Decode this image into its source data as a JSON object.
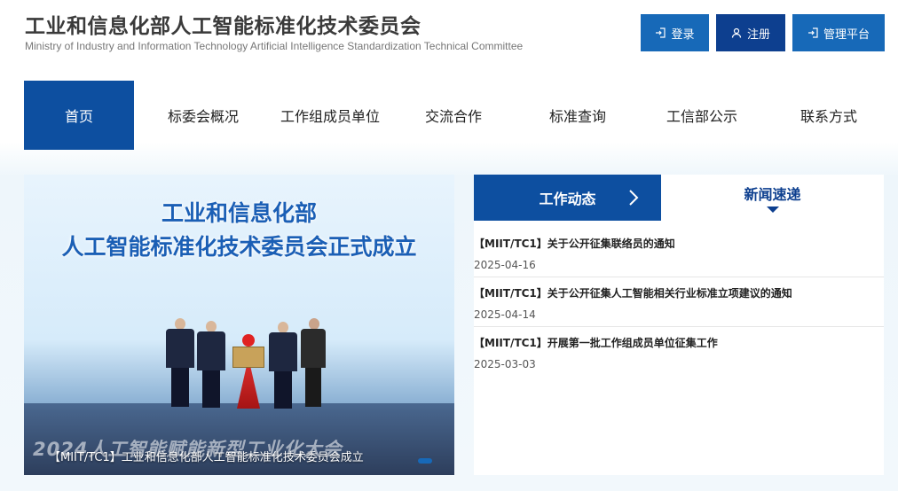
{
  "header": {
    "title": "工业和信息化部人工智能标准化技术委员会",
    "subtitle": "Ministry of Industry and Information Technology Artificial Intelligence Standardization Technical Committee",
    "buttons": {
      "login": "登录",
      "register": "注册",
      "admin": "管理平台"
    }
  },
  "nav": {
    "items": [
      "首页",
      "标委会概况",
      "工作组成员单位",
      "交流合作",
      "标准查询",
      "工信部公示",
      "联系方式"
    ],
    "active_index": 0
  },
  "banner": {
    "headline_line1": "工业和信息化部",
    "headline_line2": "人工智能标准化技术委员会正式成立",
    "backdrop_text": "2024人工智能赋能新型工业化大会",
    "caption": "【MIIT/TC1】工业和信息化部人工智能标准化技术委员会成立"
  },
  "news": {
    "tabs": {
      "work": "工作动态",
      "news": "新闻速递"
    },
    "items": [
      {
        "title": "【MIIT/TC1】关于公开征集联络员的通知",
        "date": "2025-04-16"
      },
      {
        "title": "【MIIT/TC1】关于公开征集人工智能相关行业标准立项建议的通知",
        "date": "2025-04-14"
      },
      {
        "title": "【MIIT/TC1】开展第一批工作组成员单位征集工作",
        "date": "2025-03-03"
      }
    ]
  },
  "colors": {
    "primary_blue": "#0d4fa0",
    "button_blue": "#1769b8",
    "dark_blue": "#0d3f8f"
  }
}
